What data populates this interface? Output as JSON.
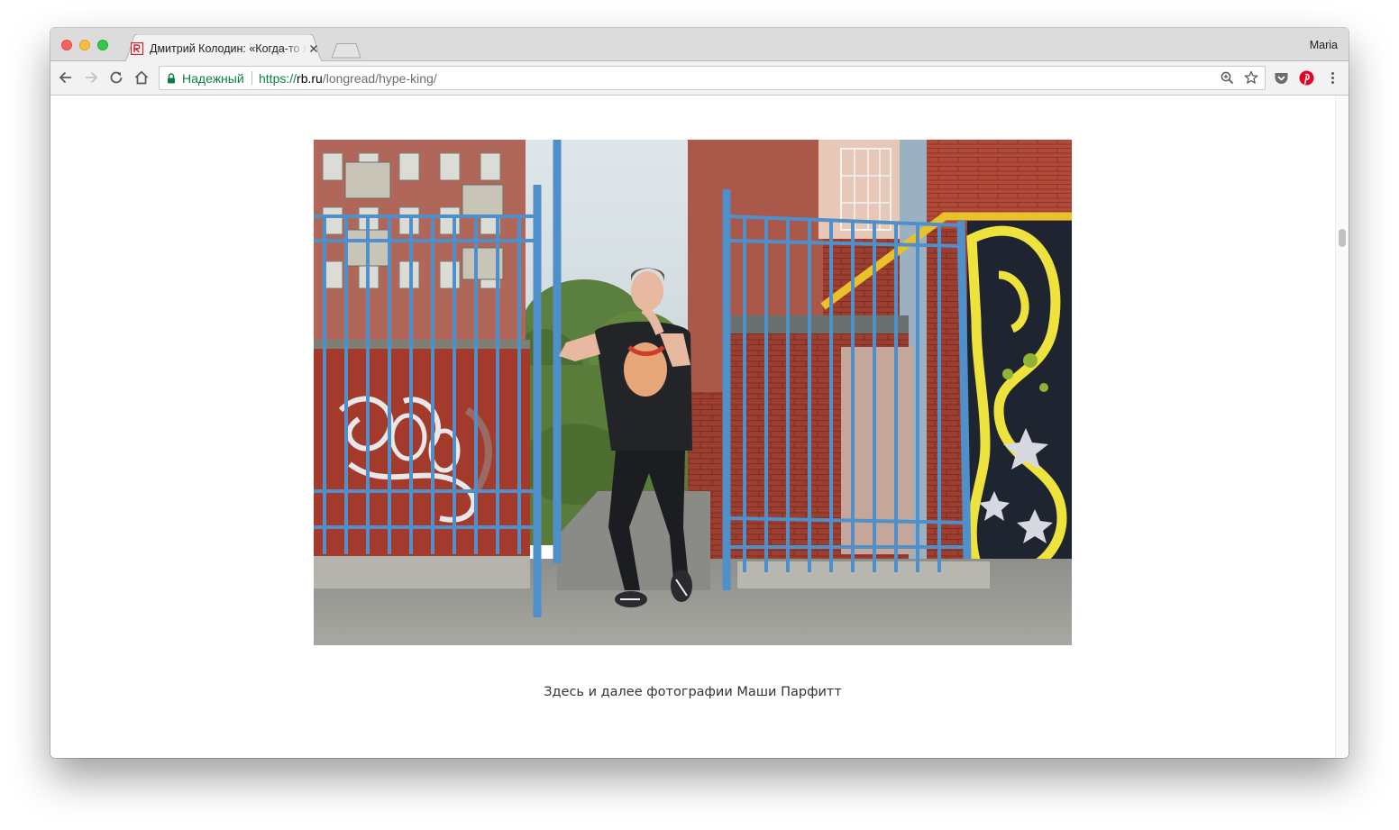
{
  "browser": {
    "tab": {
      "title": "Дмитрий Колодин: «Когда-то я",
      "favicon": "rb-logo-icon"
    },
    "profile_name": "Maria",
    "omnibox": {
      "secure_label": "Надежный",
      "url_scheme": "https://",
      "url_host": "rb.ru",
      "url_path": "/longread/hype-king/"
    },
    "icons": {
      "back": "arrow-left-icon",
      "forward": "arrow-right-icon",
      "reload": "reload-icon",
      "home": "home-icon",
      "lock": "lock-icon",
      "zoom": "zoom-icon",
      "bookmark": "star-icon",
      "pocket": "pocket-icon",
      "pinterest": "pinterest-icon",
      "menu": "kebab-menu-icon"
    }
  },
  "article": {
    "photo_alt": "Мужчина у открытых голубых ворот на фоне кирпичных домов и граффити",
    "caption": "Здесь и далее фотографии Маши Парфитт"
  },
  "colors": {
    "secure_green": "#0b8043",
    "gate_blue": "#4d8fca",
    "brick_red": "#9e3a2e",
    "pinterest_red": "#e60023"
  }
}
